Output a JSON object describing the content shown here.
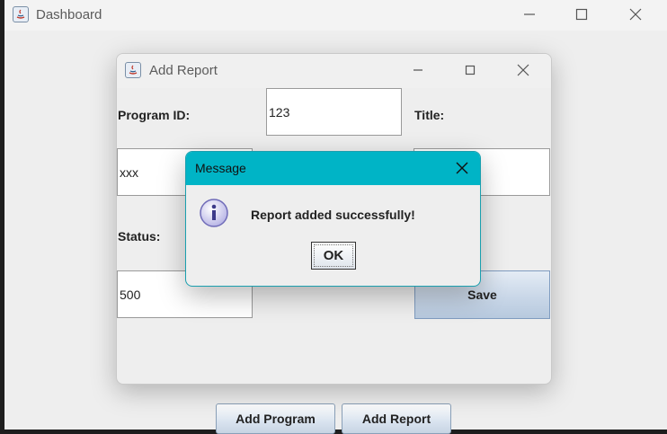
{
  "dashboard": {
    "title": "Dashboard",
    "buttons": {
      "add_program": "Add Program",
      "add_report": "Add Report"
    }
  },
  "add_report": {
    "title": "Add Report",
    "program_id_label": "Program ID:",
    "program_id_value": "123",
    "title_label": "Title:",
    "title_value": "",
    "description_value": "xxx",
    "status_label": "Status:",
    "status_value": "500",
    "save_label": "Save"
  },
  "message_dialog": {
    "title": "Message",
    "text": "Report added successfully!",
    "ok_label": "OK",
    "icon": "info-icon"
  },
  "colors": {
    "dialog_titlebar": "#00b4c6",
    "window_bg": "#eeeeee",
    "button_accent": "#c7d4e3"
  }
}
